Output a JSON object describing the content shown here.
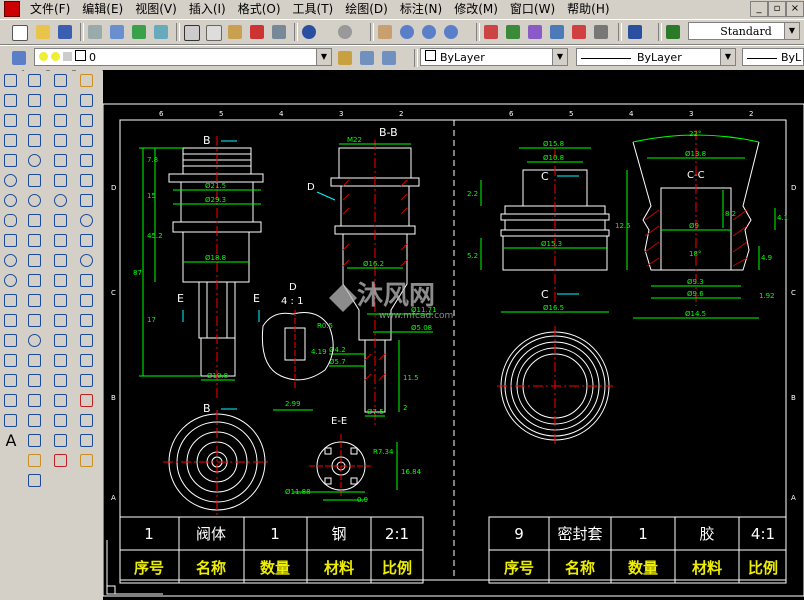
{
  "menubar": {
    "items": [
      "文件(F)",
      "编辑(E)",
      "视图(V)",
      "插入(I)",
      "格式(O)",
      "工具(T)",
      "绘图(D)",
      "标注(N)",
      "修改(M)",
      "窗口(W)",
      "帮助(H)"
    ]
  },
  "toolbar": {
    "textstyle": "Standard"
  },
  "layers": {
    "current_layer": "0",
    "color": "ByLayer",
    "linetype": "ByLayer",
    "lineweight": "ByL"
  },
  "drawing": {
    "watermark": "沐风网",
    "watermark_url": "www.mfcad.com",
    "views": {
      "B_label": "B",
      "BB_title": "B-B",
      "D_title": "D",
      "D_scale": "4 : 1",
      "E_label": "E",
      "EE_title": "E-E",
      "C_label": "C",
      "CC_title": "C-C",
      "D_arrow": "D"
    },
    "dims": {
      "d21_5": "Ø21.5",
      "d29_3": "Ø29.3",
      "d18_8": "Ø18.8",
      "d10_8": "Ø10.8",
      "v87": "87",
      "v45_2": "45.2",
      "v17": "17",
      "v15": "15",
      "v7_8": "7.8",
      "m22": "M22",
      "d16_2": "Ø16.2",
      "d11_71": "Ø11.71",
      "d5_08": "Ø5.08",
      "d4_2": "Ø4.2",
      "d5_7": "Ø5.7",
      "d7_5": "Ø7.5",
      "v11_5": "11.5",
      "v2": "2",
      "r0_5": "R0.5",
      "v4_19": "4.19",
      "v2_99": "2.99",
      "r7_34": "R7.34",
      "d11_88": "Ø11.88",
      "v0_9": "0.9",
      "v16_84": "16.84",
      "d15_8": "Ø15.8",
      "d10_8b": "Ø10.8",
      "d15_3": "Ø15.3",
      "d16_5": "Ø16.5",
      "v12_5": "12.5",
      "v5_2": "5.2",
      "v2_2": "2.2",
      "a22": "22°",
      "d13_8": "Ø13.8",
      "d9": "Ø9",
      "a18": "18°",
      "d9_3": "Ø9.3",
      "d9_6": "Ø9.6",
      "d14_5": "Ø14.5",
      "v8_2": "8.2",
      "v4_1": "4.1",
      "v4_9": "4.9",
      "v1_92": "1.92"
    },
    "title_left": {
      "row1": [
        "1",
        "阀体",
        "1",
        "钢",
        "2:1"
      ],
      "row2": [
        "序号",
        "名称",
        "数量",
        "材料",
        "比例"
      ]
    },
    "title_right": {
      "row1": [
        "9",
        "密封套",
        "1",
        "胶",
        "4:1"
      ],
      "row2": [
        "序号",
        "名称",
        "数量",
        "材料",
        "比例"
      ]
    }
  }
}
